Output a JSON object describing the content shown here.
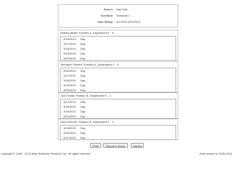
{
  "summary": {
    "search_label": "Search",
    "search_value": "Day Shift",
    "schedule_label": "Schedule",
    "schedule_value": "Schedule 1",
    "date_label": "Date Range",
    "date_value": "3/1/2015-3/31/2015"
  },
  "groups": [
    {
      "header": "Brittany Blake, Position A, Department F - 5",
      "items": [
        {
          "date": "3/16/2015",
          "shift": "Day"
        },
        {
          "date": "3/17/2015",
          "shift": "Day"
        },
        {
          "date": "3/18/2015",
          "shift": "Day"
        },
        {
          "date": "3/19/2015",
          "shift": "Day"
        },
        {
          "date": "3/20/2015",
          "shift": "Day"
        }
      ]
    },
    {
      "header": "Jermaine Flowers, Position A, Department C - 5",
      "items": [
        {
          "date": "3/16/2015",
          "shift": "Day"
        },
        {
          "date": "3/17/2015",
          "shift": "Day"
        },
        {
          "date": "3/18/2015",
          "shift": "Day"
        },
        {
          "date": "3/19/2015",
          "shift": "Day"
        },
        {
          "date": "3/20/2015",
          "shift": "Day"
        }
      ]
    },
    {
      "header": "John Smith, Position B, Department K - 4",
      "items": [
        {
          "date": "3/17/2015",
          "shift": "Day"
        },
        {
          "date": "3/18/2015",
          "shift": "Day"
        },
        {
          "date": "3/20/2015",
          "shift": "Day"
        },
        {
          "date": "3/21/2015",
          "shift": "Day"
        }
      ]
    },
    {
      "header": "Ray Emerson, Position B, Department F - 3",
      "items": [
        {
          "date": "3/19/2015",
          "shift": "Day"
        },
        {
          "date": "3/20/2015",
          "shift": "Day"
        },
        {
          "date": "3/21/2015",
          "shift": "Day"
        }
      ]
    }
  ],
  "buttons": {
    "print": "Print",
    "export": "Export to Excel",
    "cancel": "Cancel"
  },
  "footer": {
    "copyright": "Copyright © 1995 - 2013 Atlas Business Solutions, Inc. All rights reserved.",
    "best_viewed": "Best viewed in 1280x1024"
  }
}
